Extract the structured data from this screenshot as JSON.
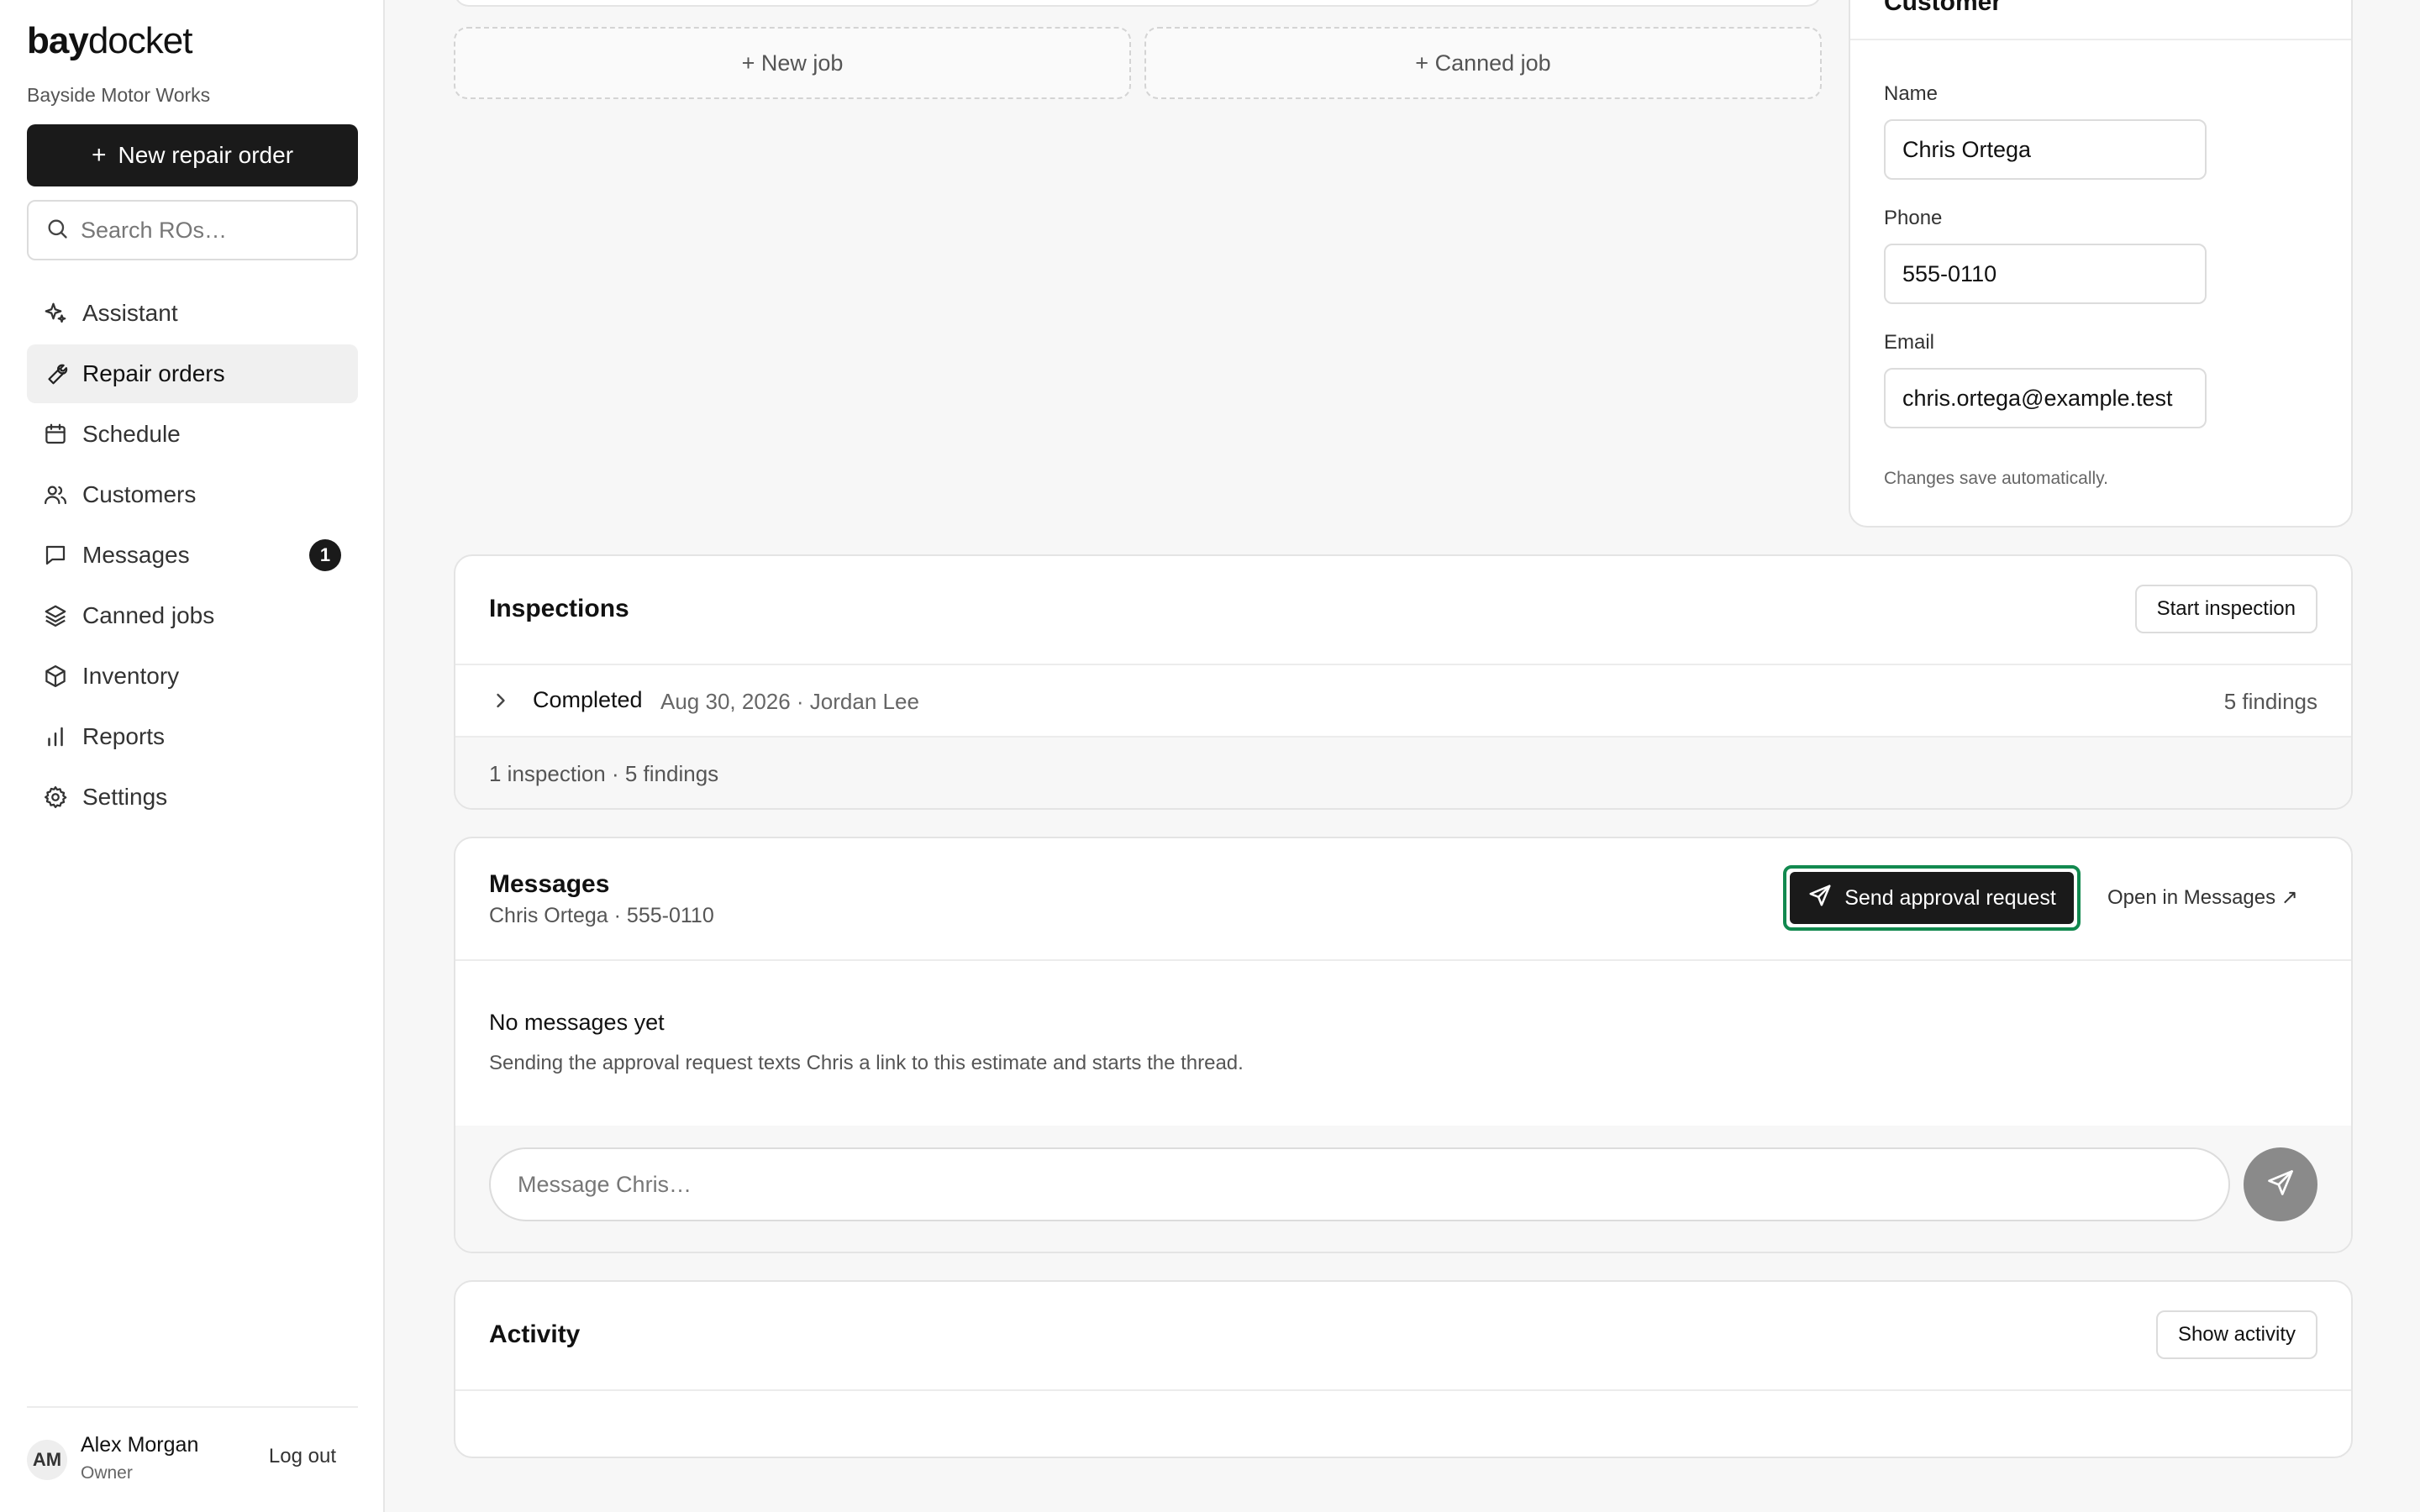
{
  "brand": {
    "bold": "bay",
    "light": "docket",
    "shop": "Bayside Motor Works"
  },
  "sidebar": {
    "new_ro_label": "New repair order",
    "new_ro_icon": "plus-icon",
    "search_placeholder": "Search ROs…",
    "items": [
      {
        "label": "Assistant",
        "icon": "sparkle-icon",
        "active": false
      },
      {
        "label": "Repair orders",
        "icon": "wrench-icon",
        "active": true
      },
      {
        "label": "Schedule",
        "icon": "calendar-icon",
        "active": false
      },
      {
        "label": "Customers",
        "icon": "users-icon",
        "active": false
      },
      {
        "label": "Messages",
        "icon": "chat-icon",
        "active": false,
        "badge": "1"
      },
      {
        "label": "Canned jobs",
        "icon": "layers-icon",
        "active": false
      },
      {
        "label": "Inventory",
        "icon": "box-icon",
        "active": false
      },
      {
        "label": "Reports",
        "icon": "bar-chart-icon",
        "active": false
      },
      {
        "label": "Settings",
        "icon": "gear-icon",
        "active": false
      }
    ],
    "user": {
      "initials": "AM",
      "name": "Alex Morgan",
      "role": "Owner",
      "logout": "Log out"
    }
  },
  "jobs": {
    "new_job": "+ New job",
    "canned_job": "+ Canned job"
  },
  "customer": {
    "title": "Customer",
    "name_label": "Name",
    "name_value": "Chris Ortega",
    "phone_label": "Phone",
    "phone_value": "555-0110",
    "email_label": "Email",
    "email_value": "chris.ortega@example.test",
    "autosave_note": "Changes save automatically."
  },
  "inspections": {
    "title": "Inspections",
    "start_button": "Start inspection",
    "row": {
      "status": "Completed",
      "meta": "Aug 30, 2026 · Jordan Lee",
      "findings": "5 findings"
    },
    "footer": "1 inspection · 5 findings"
  },
  "messages": {
    "title": "Messages",
    "subtitle": "Chris Ortega · 555-0110",
    "send_approval": "Send approval request",
    "open_in_messages": "Open in Messages ↗",
    "empty_title": "No messages yet",
    "empty_desc": "Sending the approval request texts Chris a link to this estimate and starts the thread.",
    "composer_placeholder": "Message Chris…"
  },
  "activity": {
    "title": "Activity",
    "show_button": "Show activity"
  },
  "colors": {
    "accent_dark": "#1a1a1a",
    "focus_ring": "#12894f",
    "send_disabled": "#8a8a8a"
  }
}
